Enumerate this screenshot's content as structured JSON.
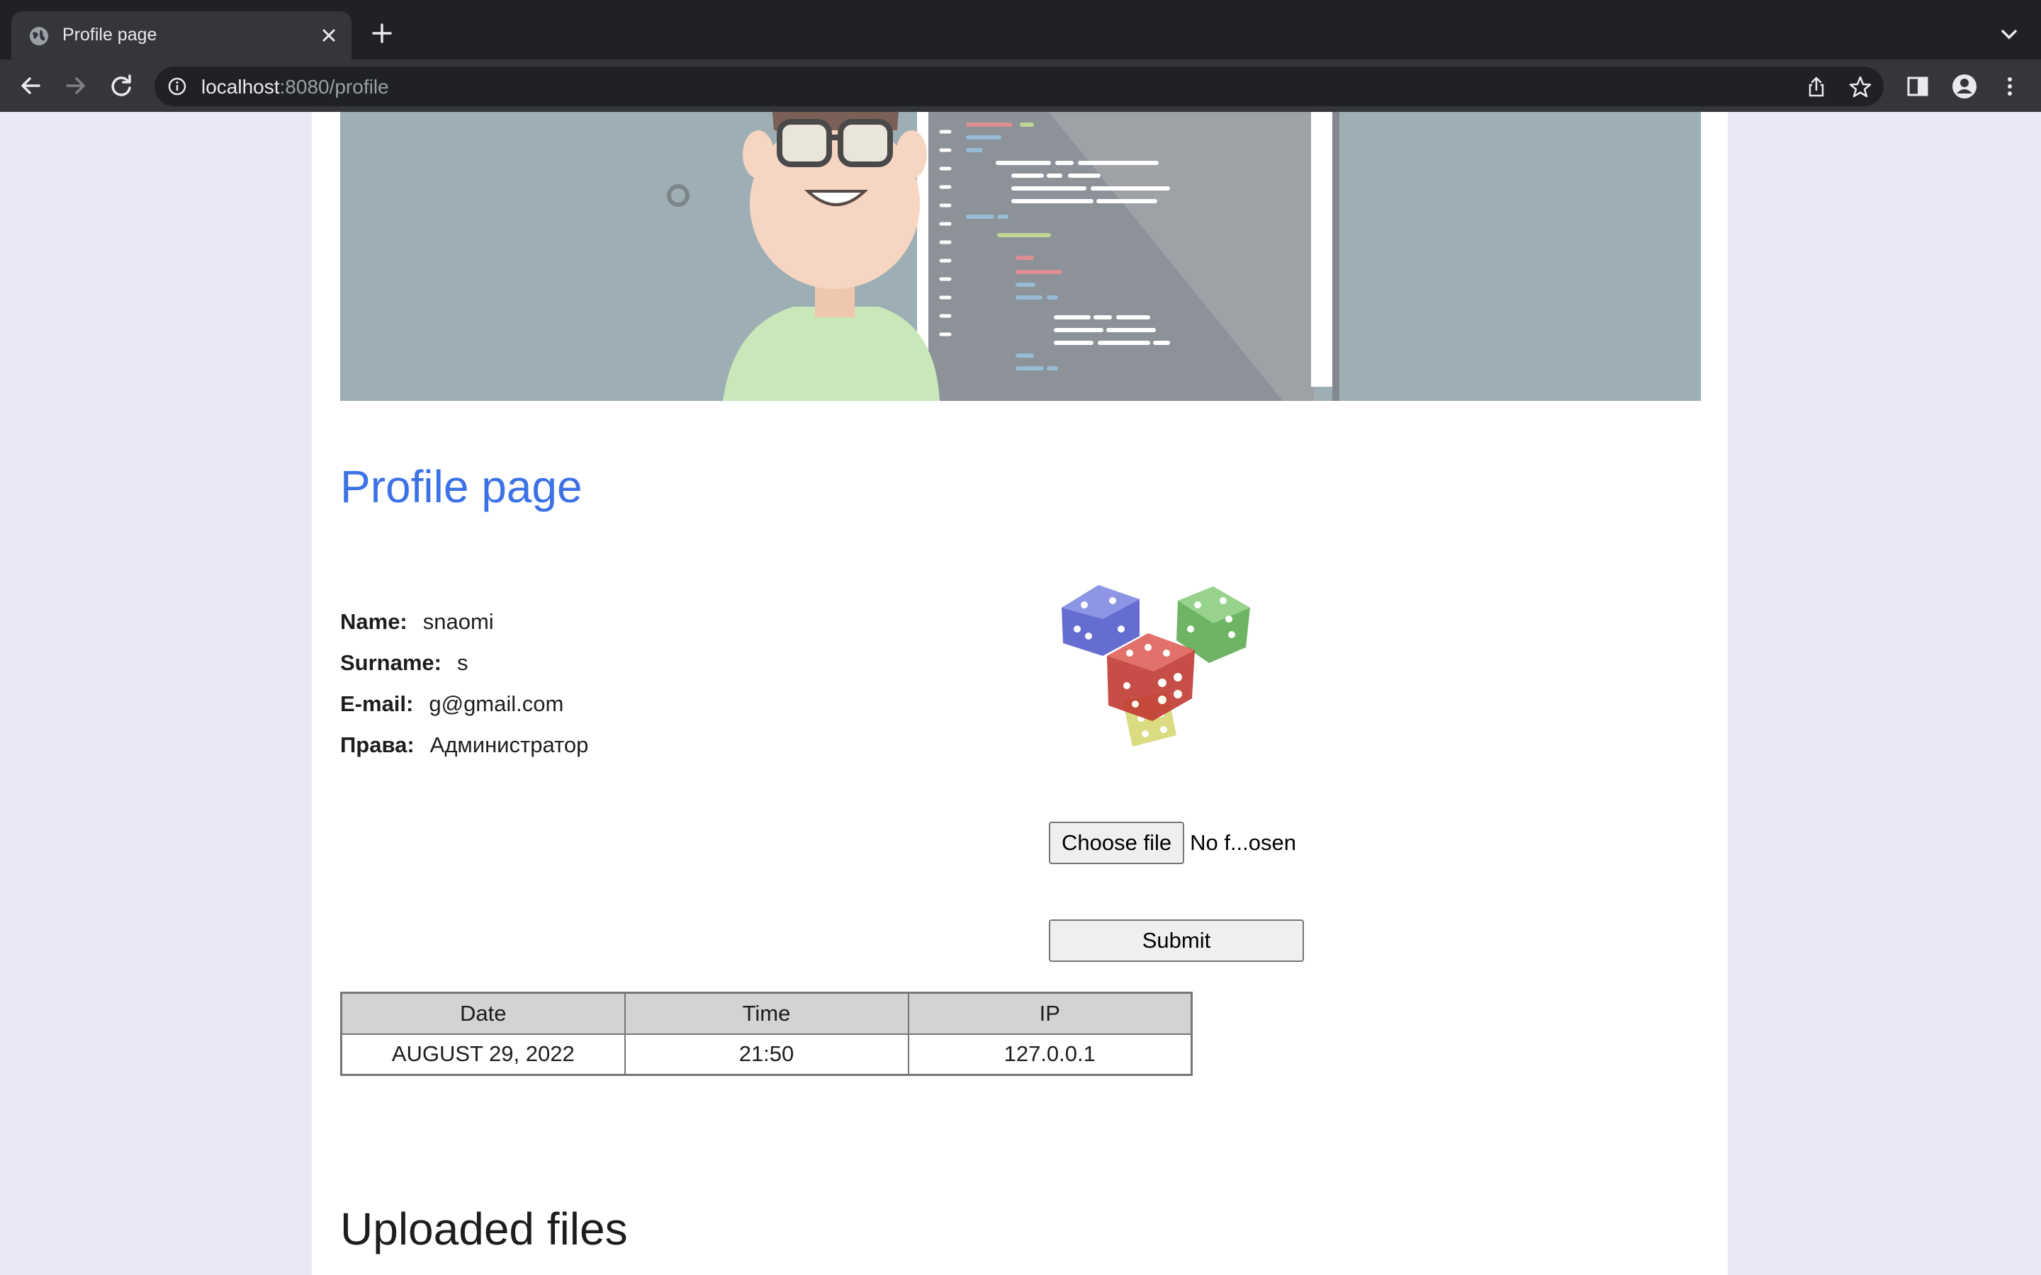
{
  "browser": {
    "tab": {
      "title": "Profile page",
      "favicon": "globe-icon"
    },
    "url": {
      "host": "localhost",
      "rest": ":8080/profile"
    },
    "icons": {
      "new_tab": "plus-icon",
      "back": "arrow-left-icon",
      "forward": "arrow-right-icon",
      "reload": "reload-icon",
      "site_info": "info-icon",
      "share": "share-icon",
      "bookmark": "star-icon",
      "side_panel": "side-panel-icon",
      "profile": "avatar-icon",
      "menu": "kebab-menu-icon",
      "tab_search": "chevron-down-icon"
    }
  },
  "page": {
    "title": "Profile page",
    "profile": [
      {
        "label": "Name:",
        "value": "snaomi"
      },
      {
        "label": "Surname:",
        "value": "s"
      },
      {
        "label": "E-mail:",
        "value": "g@gmail.com"
      },
      {
        "label": "Права:",
        "value": "Администратор"
      }
    ],
    "upload": {
      "choose_label": "Choose file",
      "status": "No f...osen",
      "submit_label": "Submit"
    },
    "log_table": {
      "headers": [
        "Date",
        "Time",
        "IP"
      ],
      "rows": [
        [
          "AUGUST 29, 2022",
          "21:50",
          "127.0.0.1"
        ]
      ]
    },
    "uploaded_title": "Uploaded files"
  },
  "colors": {
    "title_blue": "#3b72e6",
    "page_bg": "#e9e9f5",
    "chrome_dark": "#202124",
    "chrome_toolbar": "#35363a"
  }
}
